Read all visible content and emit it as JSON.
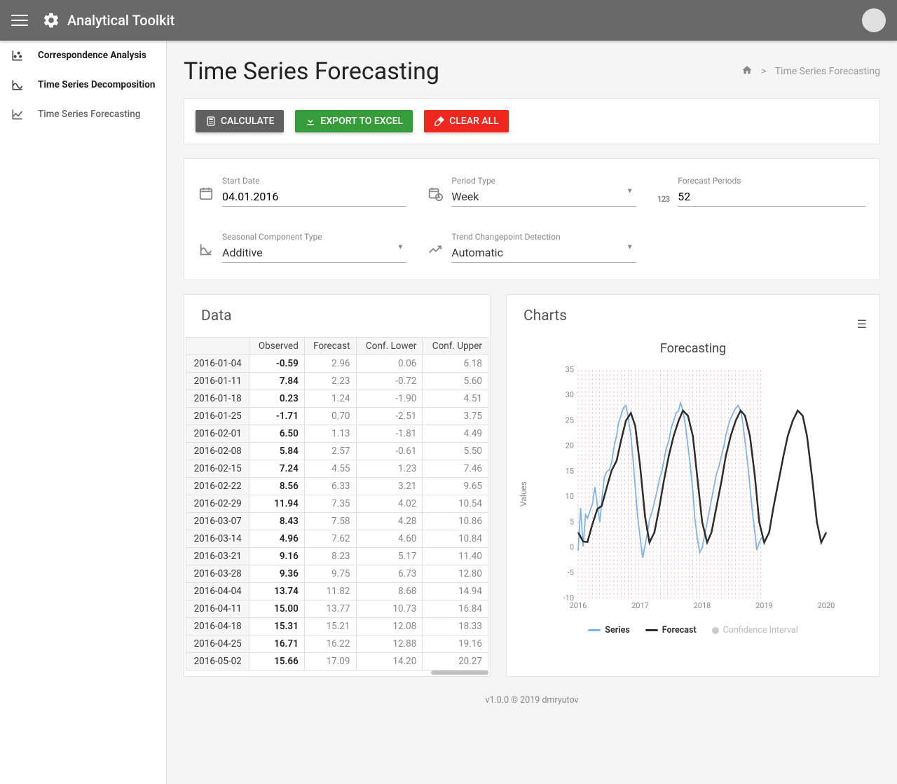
{
  "app": {
    "title": "Analytical Toolkit"
  },
  "sidebar": {
    "items": [
      {
        "label": "Correspondence Analysis",
        "active": false
      },
      {
        "label": "Time Series Decomposition",
        "active": false
      },
      {
        "label": "Time Series Forecasting",
        "active": true
      }
    ]
  },
  "page": {
    "title": "Time Series Forecasting"
  },
  "breadcrumb": {
    "sep": ">",
    "current": "Time Series Forecasting"
  },
  "buttons": {
    "calculate": "CALCULATE",
    "export": "EXPORT TO EXCEL",
    "clear": "CLEAR ALL"
  },
  "params": {
    "start_date": {
      "label": "Start Date",
      "value": "04.01.2016"
    },
    "period_type": {
      "label": "Period Type",
      "value": "Week"
    },
    "forecast_periods": {
      "label": "Forecast Periods",
      "value": "52",
      "prefix": "123"
    },
    "seasonal": {
      "label": "Seasonal Component Type",
      "value": "Additive"
    },
    "trend": {
      "label": "Trend Changepoint Detection",
      "value": "Automatic"
    }
  },
  "data_panel": {
    "title": "Data",
    "columns": [
      "",
      "Observed",
      "Forecast",
      "Conf. Lower",
      "Conf. Upper"
    ],
    "rows": [
      [
        "2016-01-04",
        "-0.59",
        "2.96",
        "0.06",
        "6.18"
      ],
      [
        "2016-01-11",
        "7.84",
        "2.23",
        "-0.72",
        "5.60"
      ],
      [
        "2016-01-18",
        "0.23",
        "1.24",
        "-1.90",
        "4.51"
      ],
      [
        "2016-01-25",
        "-1.71",
        "0.70",
        "-2.51",
        "3.75"
      ],
      [
        "2016-02-01",
        "6.50",
        "1.13",
        "-1.81",
        "4.49"
      ],
      [
        "2016-02-08",
        "5.84",
        "2.57",
        "-0.61",
        "5.50"
      ],
      [
        "2016-02-15",
        "7.24",
        "4.55",
        "1.23",
        "7.46"
      ],
      [
        "2016-02-22",
        "8.56",
        "6.33",
        "3.21",
        "9.65"
      ],
      [
        "2016-02-29",
        "11.94",
        "7.35",
        "4.02",
        "10.54"
      ],
      [
        "2016-03-07",
        "8.43",
        "7.58",
        "4.28",
        "10.86"
      ],
      [
        "2016-03-14",
        "4.96",
        "7.62",
        "4.60",
        "10.84"
      ],
      [
        "2016-03-21",
        "9.16",
        "8.23",
        "5.17",
        "11.40"
      ],
      [
        "2016-03-28",
        "9.36",
        "9.75",
        "6.73",
        "12.80"
      ],
      [
        "2016-04-04",
        "13.74",
        "11.82",
        "8.68",
        "14.94"
      ],
      [
        "2016-04-11",
        "15.00",
        "13.77",
        "10.73",
        "16.84"
      ],
      [
        "2016-04-18",
        "15.31",
        "15.21",
        "12.08",
        "18.33"
      ],
      [
        "2016-04-25",
        "16.71",
        "16.22",
        "12.88",
        "19.16"
      ],
      [
        "2016-05-02",
        "15.66",
        "17.09",
        "14.20",
        "20.27"
      ]
    ]
  },
  "charts_panel": {
    "title": "Charts"
  },
  "legend": {
    "series": "Series",
    "forecast": "Forecast",
    "ci": "Confidence Interval"
  },
  "footer": "v1.0.0 © 2019 dmryutov",
  "chart_data": {
    "type": "line",
    "title": "Forecasting",
    "ylabel": "Values",
    "xlim": [
      2016,
      2020
    ],
    "ylim": [
      -10,
      35
    ],
    "xticks": [
      2016,
      2017,
      2018,
      2019,
      2020
    ],
    "yticks": [
      -10,
      -5,
      0,
      5,
      10,
      15,
      20,
      25,
      30,
      35
    ],
    "series": [
      {
        "name": "Series",
        "color": "#7fb4ea",
        "x": [
          2016.0,
          2016.04,
          2016.08,
          2016.12,
          2016.15,
          2016.19,
          2016.23,
          2016.27,
          2016.31,
          2016.35,
          2016.38,
          2016.42,
          2016.46,
          2016.5,
          2016.54,
          2016.58,
          2016.62,
          2016.65,
          2016.69,
          2016.73,
          2016.77,
          2016.81,
          2016.85,
          2016.88,
          2016.92,
          2016.96,
          2017.0,
          2017.04,
          2017.08,
          2017.12,
          2017.15,
          2017.19,
          2017.23,
          2017.27,
          2017.31,
          2017.35,
          2017.38,
          2017.42,
          2017.46,
          2017.5,
          2017.54,
          2017.58,
          2017.62,
          2017.65,
          2017.69,
          2017.73,
          2017.77,
          2017.81,
          2017.85,
          2017.88,
          2017.92,
          2017.96,
          2018.0,
          2018.04,
          2018.08,
          2018.12,
          2018.15,
          2018.19,
          2018.23,
          2018.27,
          2018.31,
          2018.35,
          2018.38,
          2018.42,
          2018.46,
          2018.5,
          2018.54,
          2018.58,
          2018.62,
          2018.65,
          2018.69,
          2018.73,
          2018.77,
          2018.81,
          2018.85,
          2018.88,
          2018.92,
          2018.96
        ],
        "y": [
          -0.6,
          7.8,
          0.2,
          6.5,
          5.8,
          7.2,
          8.6,
          11.9,
          8.4,
          5.0,
          9.2,
          13.7,
          15.0,
          15.3,
          16.7,
          20.0,
          22.0,
          24.5,
          26.0,
          27.5,
          28.0,
          25.5,
          22.0,
          18.0,
          12.0,
          6.0,
          2.0,
          -2.0,
          0.5,
          3.0,
          5.5,
          7.0,
          9.0,
          11.0,
          13.5,
          15.0,
          17.0,
          19.5,
          21.0,
          23.5,
          25.0,
          26.5,
          27.0,
          28.5,
          27.0,
          24.0,
          20.0,
          16.0,
          11.0,
          6.0,
          2.0,
          -1.0,
          0.0,
          2.5,
          5.0,
          7.5,
          9.5,
          12.0,
          14.5,
          16.0,
          18.0,
          20.0,
          22.0,
          24.0,
          25.5,
          26.5,
          27.5,
          28.0,
          27.0,
          25.0,
          21.0,
          17.0,
          12.0,
          7.0,
          3.0,
          -0.5,
          1.0,
          2.0
        ]
      },
      {
        "name": "Forecast",
        "color": "#2c2c2c",
        "x": [
          2016.0,
          2016.08,
          2016.15,
          2016.23,
          2016.31,
          2016.38,
          2016.46,
          2016.54,
          2016.62,
          2016.69,
          2016.77,
          2016.85,
          2016.92,
          2017.0,
          2017.08,
          2017.15,
          2017.23,
          2017.31,
          2017.38,
          2017.46,
          2017.54,
          2017.62,
          2017.69,
          2017.77,
          2017.85,
          2017.92,
          2018.0,
          2018.08,
          2018.15,
          2018.23,
          2018.31,
          2018.38,
          2018.46,
          2018.54,
          2018.62,
          2018.69,
          2018.77,
          2018.85,
          2018.92,
          2019.0,
          2019.08,
          2019.15,
          2019.23,
          2019.31,
          2019.38,
          2019.46,
          2019.54,
          2019.62,
          2019.69,
          2019.77,
          2019.85,
          2019.92,
          2020.0
        ],
        "y": [
          3.0,
          1.2,
          1.1,
          4.6,
          7.6,
          8.2,
          11.8,
          15.2,
          17.1,
          21.0,
          25.0,
          26.5,
          24.0,
          16.0,
          6.0,
          1.0,
          3.0,
          8.0,
          13.0,
          18.0,
          22.0,
          25.0,
          27.0,
          26.0,
          22.0,
          14.0,
          5.0,
          1.0,
          3.0,
          8.0,
          13.0,
          18.0,
          22.0,
          25.0,
          27.0,
          26.0,
          22.0,
          14.0,
          5.0,
          1.0,
          3.0,
          8.0,
          13.0,
          18.0,
          22.0,
          25.0,
          27.0,
          26.0,
          22.0,
          14.0,
          5.0,
          1.0,
          3.0
        ]
      }
    ]
  }
}
